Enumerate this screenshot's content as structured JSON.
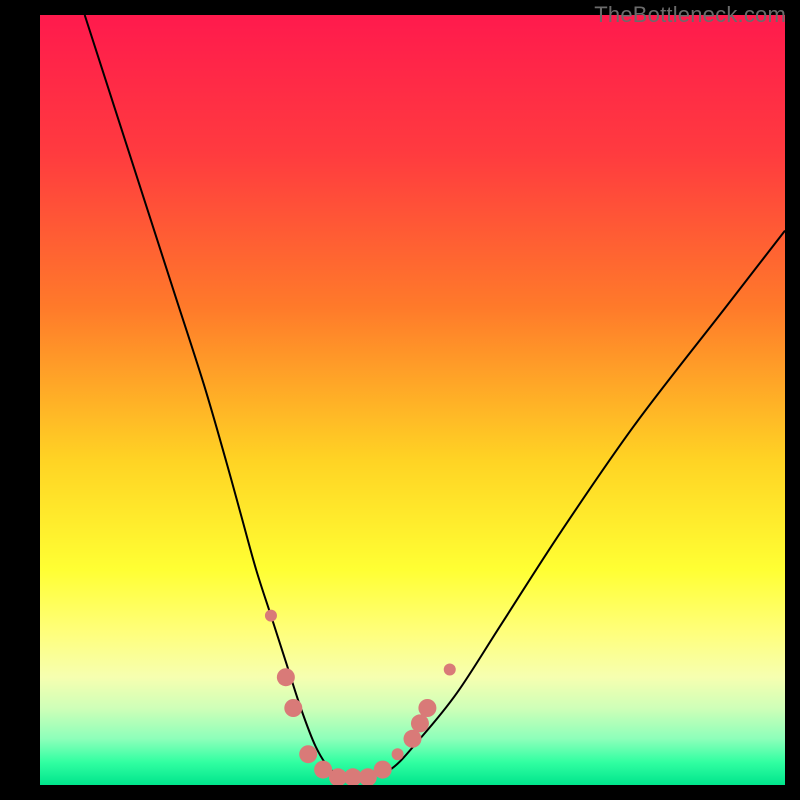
{
  "watermark": "TheBottleneck.com",
  "chart_data": {
    "type": "line",
    "title": "",
    "xlabel": "",
    "ylabel": "",
    "xlim": [
      0,
      100
    ],
    "ylim": [
      0,
      100
    ],
    "background_gradient_stops": [
      {
        "offset": 0.0,
        "color": "#ff1a4d"
      },
      {
        "offset": 0.18,
        "color": "#ff3b3f"
      },
      {
        "offset": 0.38,
        "color": "#ff7a2a"
      },
      {
        "offset": 0.58,
        "color": "#ffd424"
      },
      {
        "offset": 0.72,
        "color": "#ffff33"
      },
      {
        "offset": 0.8,
        "color": "#ffff7a"
      },
      {
        "offset": 0.86,
        "color": "#f6ffb0"
      },
      {
        "offset": 0.9,
        "color": "#cfffb8"
      },
      {
        "offset": 0.94,
        "color": "#8dffba"
      },
      {
        "offset": 0.97,
        "color": "#32ffa2"
      },
      {
        "offset": 1.0,
        "color": "#00e58c"
      }
    ],
    "series": [
      {
        "name": "bottleneck-curve",
        "color": "#000000",
        "width": 2,
        "x": [
          6,
          10,
          14,
          18,
          22,
          25,
          27,
          29,
          31,
          33,
          35,
          37,
          39,
          41,
          43,
          47,
          51,
          56,
          62,
          70,
          80,
          92,
          100
        ],
        "y": [
          100,
          88,
          76,
          64,
          52,
          42,
          35,
          28,
          22,
          16,
          10,
          5,
          2,
          1,
          1,
          2,
          6,
          12,
          21,
          33,
          47,
          62,
          72
        ]
      }
    ],
    "markers": {
      "name": "highlight-points",
      "color": "#d97a78",
      "radius_large": 9,
      "radius_small": 6,
      "points": [
        {
          "x": 31,
          "y": 22,
          "r": "small"
        },
        {
          "x": 33,
          "y": 14,
          "r": "large"
        },
        {
          "x": 34,
          "y": 10,
          "r": "large"
        },
        {
          "x": 36,
          "y": 4,
          "r": "large"
        },
        {
          "x": 38,
          "y": 2,
          "r": "large"
        },
        {
          "x": 40,
          "y": 1,
          "r": "large"
        },
        {
          "x": 42,
          "y": 1,
          "r": "large"
        },
        {
          "x": 44,
          "y": 1,
          "r": "large"
        },
        {
          "x": 46,
          "y": 2,
          "r": "large"
        },
        {
          "x": 48,
          "y": 4,
          "r": "small"
        },
        {
          "x": 50,
          "y": 6,
          "r": "large"
        },
        {
          "x": 51,
          "y": 8,
          "r": "large"
        },
        {
          "x": 52,
          "y": 10,
          "r": "large"
        },
        {
          "x": 55,
          "y": 15,
          "r": "small"
        }
      ]
    }
  }
}
